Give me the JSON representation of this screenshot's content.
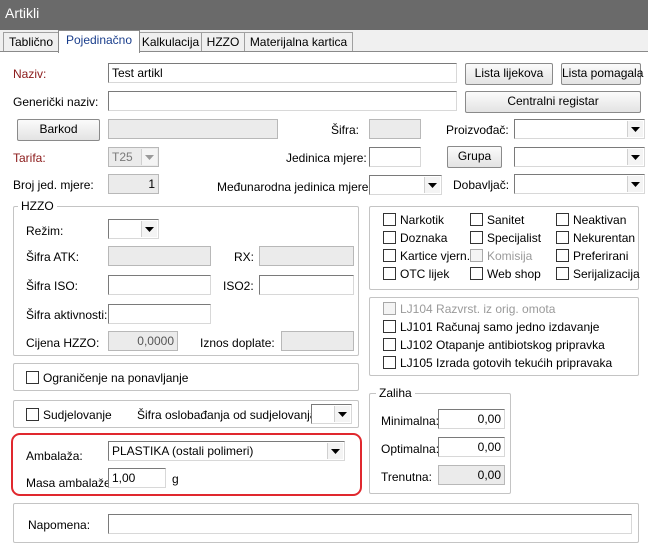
{
  "window": {
    "title": "Artikli"
  },
  "tabs": [
    {
      "label": "Tablično"
    },
    {
      "label": "Pojedinačno"
    },
    {
      "label": "Kalkulacija"
    },
    {
      "label": "HZZO"
    },
    {
      "label": "Materijalna kartica"
    }
  ],
  "form": {
    "naziv_label": "Naziv:",
    "naziv_value": "Test artikl",
    "genericki_label": "Generički naziv:",
    "genericki_value": "",
    "lista_lijekova_btn": "Lista lijekova",
    "lista_pomagala_btn": "Lista pomagala",
    "centralni_registar_btn": "Centralni registar",
    "barkod_btn": "Barkod",
    "barkod_value": "",
    "sifra_label": "Šifra:",
    "sifra_value": "",
    "proizvodjac_label": "Proizvođač:",
    "proizvodjac_value": "",
    "tarifa_label": "Tarifa:",
    "tarifa_value": "T25",
    "jedinica_mjere_label": "Jedinica mjere:",
    "jedinica_mjere_value": "",
    "grupa_btn": "Grupa",
    "grupa_value": "",
    "broj_jed_label": "Broj jed. mjere:",
    "broj_jed_value": "1",
    "medjunarodna_label": "Međunarodna jedinica mjere:",
    "medjunarodna_value": "",
    "dobavljac_label": "Dobavljač:",
    "dobavljac_value": ""
  },
  "hzzo": {
    "title": "HZZO",
    "rezim_label": "Režim:",
    "rezim_value": "",
    "sifra_atk_label": "Šifra ATK:",
    "rx_label": "RX:",
    "sifra_iso_label": "Šifra ISO:",
    "iso2_label": "ISO2:",
    "sifra_aktivnosti_label": "Šifra aktivnosti:",
    "cijena_label": "Cijena HZZO:",
    "cijena_value": "0,0000",
    "iznos_label": "Iznos doplate:",
    "iznos_value": ""
  },
  "flags": {
    "col1": [
      "Narkotik",
      "Doznaka",
      "Kartice vjern.",
      "OTC lijek"
    ],
    "col2": [
      "Sanitet",
      "Specijalist",
      "Komisija",
      "Web shop"
    ],
    "col3": [
      "Neaktivan",
      "Nekurentan",
      "Preferirani",
      "Serijalizacija"
    ]
  },
  "lj": {
    "items": [
      "LJ104 Razvrst. iz orig. omota",
      "LJ101 Računaj samo jedno izdavanje",
      "LJ102 Otapanje antibiotskog pripravka",
      "LJ105 Izrada gotovih tekućih pripravaka"
    ]
  },
  "ogranicenje": {
    "label": "Ograničenje na ponavljanje"
  },
  "sudjelovanje": {
    "label": "Sudjelovanje",
    "sifra_label": "Šifra oslobađanja od sudjelovanja:",
    "sifra_value": ""
  },
  "zaliha": {
    "title": "Zaliha",
    "minimalna_label": "Minimalna:",
    "minimalna_value": "0,00",
    "optimalna_label": "Optimalna:",
    "optimalna_value": "0,00",
    "trenutna_label": "Trenutna:",
    "trenutna_value": "0,00"
  },
  "ambalaza": {
    "label": "Ambalaža:",
    "value": "PLASTIKA (ostali polimeri)",
    "masa_label": "Masa ambalaže:",
    "masa_value": "1,00",
    "unit": "g"
  },
  "napomena": {
    "label": "Napomena:",
    "value": ""
  },
  "colors": {
    "label_required": "#8b1a1a",
    "tab_active": "#1a3e8c",
    "highlight": "#e0282e"
  }
}
